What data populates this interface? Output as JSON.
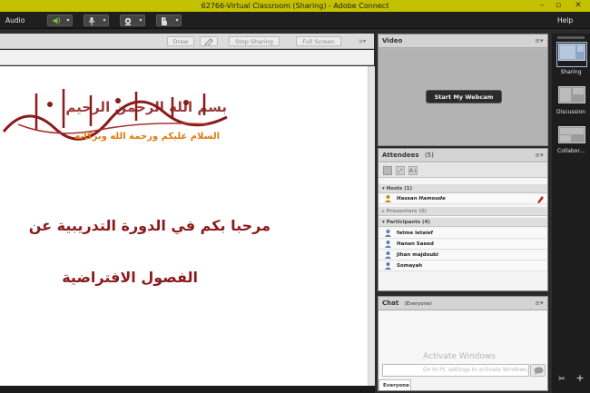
{
  "window": {
    "title": "62766-Virtual Classroom (Sharing) - Adobe Connect"
  },
  "menubar": {
    "audio_label": "Audio",
    "help_label": "Help"
  },
  "share_pod": {
    "draw_label": "Draw",
    "stop_sharing_label": "Stop Sharing",
    "full_screen_label": "Full Screen",
    "slide": {
      "calligraphy_line_1": "بسم الله الرحمن الرحيم",
      "calligraphy_line_2": "السلام عليكم ورحمة الله وبركاته",
      "welcome_line_1": "مرحبا بكم في الدورة التدريبية عن",
      "welcome_line_2": "الفصول الافتراضية"
    }
  },
  "video_pod": {
    "title": "Video",
    "start_webcam_label": "Start My Webcam"
  },
  "attendees_pod": {
    "title": "Attendees",
    "count": "(5)",
    "hosts_label": "Hosts (1)",
    "presenters_label": "Presenters (0)",
    "participants_label": "Participants (4)",
    "host_name": "Hassan Hamoude",
    "participants": [
      "fatme letaief",
      "Hanan Saeed",
      "jihan majdoubi",
      "Somayah"
    ]
  },
  "chat_pod": {
    "title": "Chat",
    "scope": "(Everyone)",
    "tab_label": "Everyone",
    "watermark_title": "Activate Windows",
    "watermark_sub": "Go to PC settings to activate Windows."
  },
  "layouts_bar": {
    "items": [
      {
        "label": "Sharing"
      },
      {
        "label": "Discussion"
      },
      {
        "label": "Collabor..."
      }
    ]
  },
  "colors": {
    "titlebar": "#c3c100",
    "menubar": "#1f1f1f",
    "arabic_text": "#8b1a1a",
    "calligraphy_secondary": "#e07a10",
    "active_layout": "#8ea6c6"
  },
  "icons": [
    "speaker-icon",
    "microphone-icon",
    "webcam-icon",
    "raise-hand-icon",
    "pod-menu-icon",
    "person-icon",
    "host-icon",
    "send-message-icon",
    "add-layout-icon",
    "tools-icon"
  ]
}
